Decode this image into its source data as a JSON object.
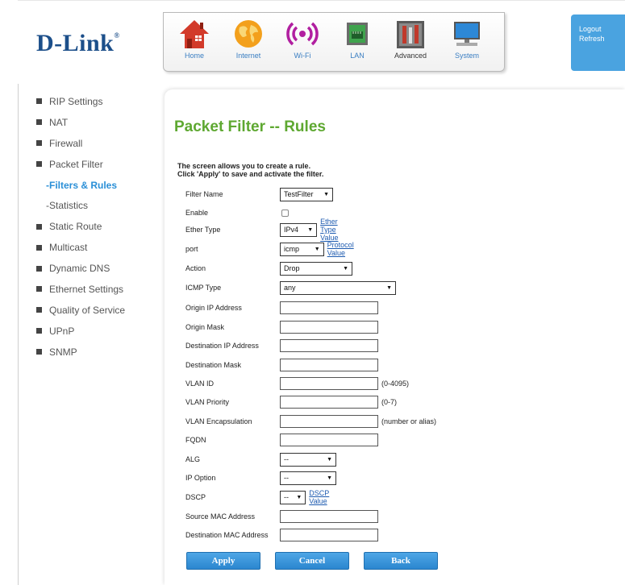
{
  "brand": {
    "logo_text": "D-Link",
    "registered_mark": "®"
  },
  "top_nav": {
    "items": [
      {
        "label": "Home",
        "icon": "home-icon"
      },
      {
        "label": "Internet",
        "icon": "globe-icon"
      },
      {
        "label": "Wi-Fi",
        "icon": "wifi-icon"
      },
      {
        "label": "LAN",
        "icon": "lan-port-icon"
      },
      {
        "label": "Advanced",
        "icon": "tools-icon"
      },
      {
        "label": "System",
        "icon": "computer-icon"
      }
    ]
  },
  "user_menu": {
    "logout": "Logout",
    "refresh": "Refresh"
  },
  "sidebar": {
    "items": [
      {
        "label": "RIP Settings"
      },
      {
        "label": "NAT"
      },
      {
        "label": "Firewall"
      },
      {
        "label": "Packet Filter"
      },
      {
        "label": "-Filters & Rules"
      },
      {
        "label": "-Statistics"
      },
      {
        "label": "Static Route"
      },
      {
        "label": "Multicast"
      },
      {
        "label": "Dynamic DNS"
      },
      {
        "label": "Ethernet Settings"
      },
      {
        "label": "Quality of Service"
      },
      {
        "label": "UPnP"
      },
      {
        "label": "SNMP"
      }
    ]
  },
  "page": {
    "title": "Packet Filter -- Rules",
    "intro_line1": "The screen allows you to create a rule.",
    "intro_line2": "Click 'Apply' to save and activate the filter."
  },
  "form": {
    "filter_name": {
      "label": "Filter Name",
      "value": "TestFilter"
    },
    "enable": {
      "label": "Enable",
      "checked": false
    },
    "ether_type": {
      "label": "Ether Type",
      "value": "IPv4",
      "link": "Ether Type Value"
    },
    "port": {
      "label": "port",
      "value": "icmp",
      "link": "Protocol Value"
    },
    "action": {
      "label": "Action",
      "value": "Drop"
    },
    "icmp_type": {
      "label": "ICMP Type",
      "value": "any"
    },
    "origin_ip": {
      "label": "Origin IP Address",
      "value": ""
    },
    "origin_mask": {
      "label": "Origin Mask",
      "value": ""
    },
    "dest_ip": {
      "label": "Destination IP Address",
      "value": ""
    },
    "dest_mask": {
      "label": "Destination Mask",
      "value": ""
    },
    "vlan_id": {
      "label": "VLAN ID",
      "value": "",
      "hint": "(0-4095)"
    },
    "vlan_priority": {
      "label": "VLAN Priority",
      "value": "",
      "hint": "(0-7)"
    },
    "vlan_encap": {
      "label": "VLAN Encapsulation",
      "value": "",
      "hint": "(number or alias)"
    },
    "fqdn": {
      "label": "FQDN",
      "value": ""
    },
    "alg": {
      "label": "ALG",
      "value": "--"
    },
    "ip_option": {
      "label": "IP Option",
      "value": "--"
    },
    "dscp": {
      "label": "DSCP",
      "value": "--",
      "link": "DSCP Value"
    },
    "src_mac": {
      "label": "Source MAC Address",
      "value": ""
    },
    "dst_mac": {
      "label": "Destination MAC Address",
      "value": ""
    }
  },
  "buttons": {
    "apply": "Apply",
    "cancel": "Cancel",
    "back": "Back"
  },
  "colors": {
    "accent_blue": "#2a8fd7",
    "title_green": "#5ea831",
    "logo_navy": "#1c4f8a",
    "userbox_blue": "#4aa3e0"
  }
}
